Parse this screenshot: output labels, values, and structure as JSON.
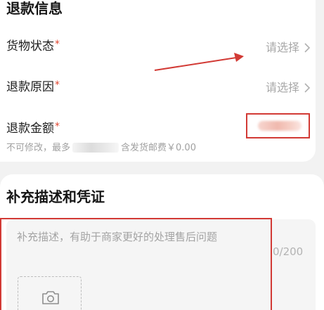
{
  "refund_info": {
    "title": "退款信息",
    "goods_status": {
      "label": "货物状态",
      "required_mark": "*",
      "value": "请选择"
    },
    "refund_reason": {
      "label": "退款原因",
      "required_mark": "*",
      "value": "请选择"
    },
    "refund_amount": {
      "label": "退款金额",
      "required_mark": "*"
    },
    "amount_hint": {
      "prefix": "不可修改，最多",
      "suffix": "含发货邮费￥0.00"
    }
  },
  "supplement": {
    "title": "补充描述和凭证",
    "placeholder": "补充描述，有助于商家更好的处理售后问题",
    "counter": "0/200"
  },
  "icons": {
    "chevron": "chevron-right-icon",
    "camera": "camera-icon"
  },
  "colors": {
    "required": "#e0452f",
    "annotation": "#d23a35",
    "placeholder": "#a3a3a3"
  }
}
